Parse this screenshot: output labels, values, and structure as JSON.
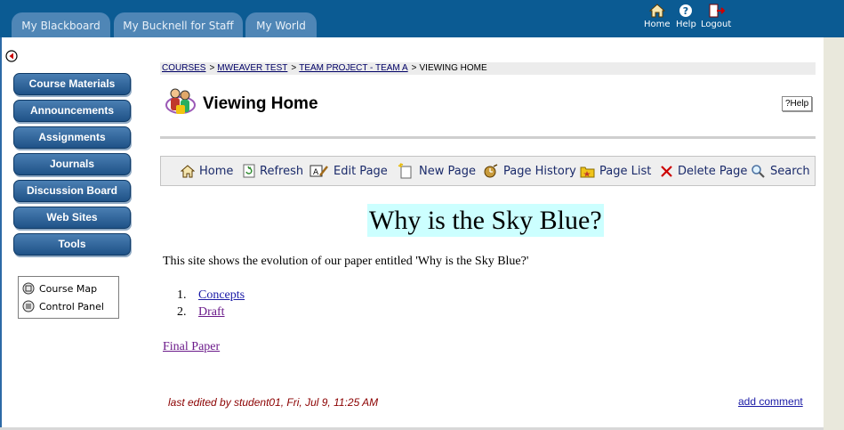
{
  "tabs": [
    "My Blackboard",
    "My Bucknell for Staff",
    "My World"
  ],
  "top_icons": [
    {
      "label": "Home",
      "icon": "home-icon"
    },
    {
      "label": "Help",
      "icon": "help-icon"
    },
    {
      "label": "Logout",
      "icon": "logout-icon"
    }
  ],
  "nav_buttons": [
    "Course Materials",
    "Announcements",
    "Assignments",
    "Journals",
    "Discussion Board",
    "Web Sites",
    "Tools"
  ],
  "toolbox": [
    "Course Map",
    "Control Panel"
  ],
  "breadcrumb": [
    "COURSES",
    "MWEAVER TEST",
    "TEAM PROJECT - TEAM A",
    "VIEWING HOME"
  ],
  "page_title": "Viewing Home",
  "help_button": "?Help",
  "wiki_toolbar": [
    "Home",
    "Refresh",
    "Edit Page",
    "New Page",
    "Page History",
    "Page List",
    "Delete Page",
    "Search"
  ],
  "content": {
    "headline": "Why is the Sky Blue?",
    "intro": "This site shows the evolution of our paper entitled 'Why is the Sky Blue?'",
    "list": [
      {
        "num": "1.",
        "label": "Concepts"
      },
      {
        "num": "2.",
        "label": "Draft"
      }
    ],
    "final_paper": "Final Paper",
    "last_edited": "last edited by student01, Fri, Jul 9, 11:25 AM",
    "add_comment": "add comment"
  },
  "colors": {
    "topbar": "#0b5b93",
    "tab": "#4f86b6",
    "headline_bg": "#ccffff",
    "last_edited": "#8b0000"
  }
}
